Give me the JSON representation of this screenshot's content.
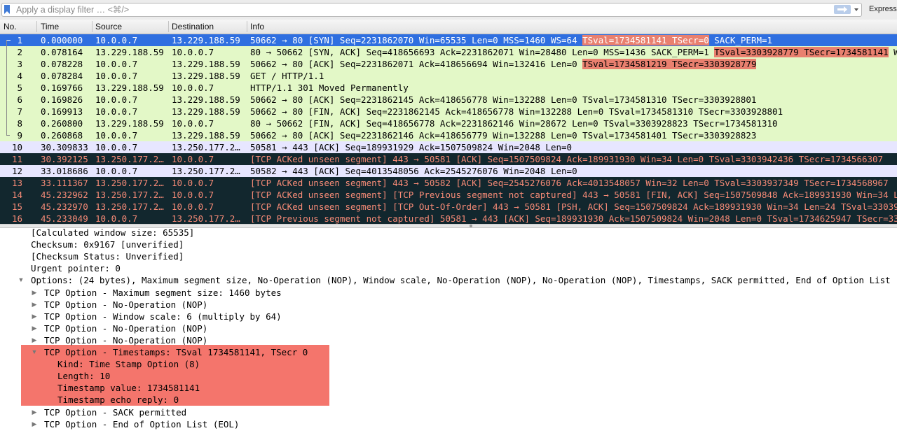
{
  "filter": {
    "placeholder": "Apply a display filter … <⌘/>",
    "expression_label": "Expressio"
  },
  "columns": {
    "no": "No.",
    "time": "Time",
    "source": "Source",
    "destination": "Destination",
    "info": "Info"
  },
  "packets": [
    {
      "no": "1",
      "time": "0.000000",
      "src": "10.0.0.7",
      "dst": "13.229.188.59",
      "info_a": "50662 → 80 [SYN] Seq=2231862070 Win=65535 Len=0 MSS=1460 WS=64 ",
      "info_hl": "TSval=1734581141 TSecr=0",
      "info_b": " SACK_PERM=1",
      "style": "selected"
    },
    {
      "no": "2",
      "time": "0.078164",
      "src": "13.229.188.59",
      "dst": "10.0.0.7",
      "info_a": "80 → 50662 [SYN, ACK] Seq=418656693 Ack=2231862071 Win=28480 Len=0 MSS=1436 SACK_PERM=1 ",
      "info_hl": "TSval=3303928779 TSecr=1734581141",
      "info_b": " WS",
      "style": "green"
    },
    {
      "no": "3",
      "time": "0.078228",
      "src": "10.0.0.7",
      "dst": "13.229.188.59",
      "info_a": "50662 → 80 [ACK] Seq=2231862071 Ack=418656694 Win=132416 Len=0 ",
      "info_hl": "TSval=1734581219 TSecr=3303928779 ",
      "info_b": "",
      "style": "green"
    },
    {
      "no": "4",
      "time": "0.078284",
      "src": "10.0.0.7",
      "dst": "13.229.188.59",
      "info_a": "GET / HTTP/1.1",
      "info_hl": "",
      "info_b": "",
      "style": "green"
    },
    {
      "no": "5",
      "time": "0.169766",
      "src": "13.229.188.59",
      "dst": "10.0.0.7",
      "info_a": "HTTP/1.1 301 Moved Permanently",
      "info_hl": "",
      "info_b": "",
      "style": "green"
    },
    {
      "no": "6",
      "time": "0.169826",
      "src": "10.0.0.7",
      "dst": "13.229.188.59",
      "info_a": "50662 → 80 [ACK] Seq=2231862145 Ack=418656778 Win=132288 Len=0 TSval=1734581310 TSecr=3303928801",
      "info_hl": "",
      "info_b": "",
      "style": "green"
    },
    {
      "no": "7",
      "time": "0.169913",
      "src": "10.0.0.7",
      "dst": "13.229.188.59",
      "info_a": "50662 → 80 [FIN, ACK] Seq=2231862145 Ack=418656778 Win=132288 Len=0 TSval=1734581310 TSecr=3303928801",
      "info_hl": "",
      "info_b": "",
      "style": "green"
    },
    {
      "no": "8",
      "time": "0.260800",
      "src": "13.229.188.59",
      "dst": "10.0.0.7",
      "info_a": "80 → 50662 [FIN, ACK] Seq=418656778 Ack=2231862146 Win=28672 Len=0 TSval=3303928823 TSecr=1734581310",
      "info_hl": "",
      "info_b": "",
      "style": "green"
    },
    {
      "no": "9",
      "time": "0.260868",
      "src": "10.0.0.7",
      "dst": "13.229.188.59",
      "info_a": "50662 → 80 [ACK] Seq=2231862146 Ack=418656779 Win=132288 Len=0 TSval=1734581401 TSecr=3303928823",
      "info_hl": "",
      "info_b": "",
      "style": "green"
    },
    {
      "no": "10",
      "time": "30.309833",
      "src": "10.0.0.7",
      "dst": "13.250.177.2…",
      "info_a": "50581 → 443 [ACK] Seq=189931929 Ack=1507509824 Win=2048 Len=0",
      "info_hl": "",
      "info_b": "",
      "style": "lav"
    },
    {
      "no": "11",
      "time": "30.392125",
      "src": "13.250.177.2…",
      "dst": "10.0.0.7",
      "info_a": "[TCP ACKed unseen segment] 443 → 50581 [ACK] Seq=1507509824 Ack=189931930 Win=34 Len=0 TSval=3303942436 TSecr=1734566307",
      "info_hl": "",
      "info_b": "",
      "style": "dark"
    },
    {
      "no": "12",
      "time": "33.018686",
      "src": "10.0.0.7",
      "dst": "13.250.177.2…",
      "info_a": "50582 → 443 [ACK] Seq=4013548056 Ack=2545276076 Win=2048 Len=0",
      "info_hl": "",
      "info_b": "",
      "style": "lav"
    },
    {
      "no": "13",
      "time": "33.111367",
      "src": "13.250.177.2…",
      "dst": "10.0.0.7",
      "info_a": "[TCP ACKed unseen segment] 443 → 50582 [ACK] Seq=2545276076 Ack=4013548057 Win=32 Len=0 TSval=3303937349 TSecr=1734568967",
      "info_hl": "",
      "info_b": "",
      "style": "dark"
    },
    {
      "no": "14",
      "time": "45.232962",
      "src": "13.250.177.2…",
      "dst": "10.0.0.7",
      "info_a": "[TCP ACKed unseen segment] [TCP Previous segment not captured] 443 → 50581 [FIN, ACK] Seq=1507509848 Ack=189931930 Win=34 Le",
      "info_hl": "",
      "info_b": "",
      "style": "dark"
    },
    {
      "no": "15",
      "time": "45.232970",
      "src": "13.250.177.2…",
      "dst": "10.0.0.7",
      "info_a": "[TCP ACKed unseen segment] [TCP Out-Of-Order] 443 → 50581 [PSH, ACK] Seq=1507509824 Ack=189931930 Win=34 Len=24 TSval=330394",
      "info_hl": "",
      "info_b": "",
      "style": "dark"
    },
    {
      "no": "16",
      "time": "45.233049",
      "src": "10.0.0.7",
      "dst": "13.250.177.2…",
      "info_a": "[TCP Previous segment not captured] 50581 → 443 [ACK] Seq=189931930 Ack=1507509824 Win=2048 Len=0 TSval=1734625947 TSecr=330",
      "info_hl": "",
      "info_b": "",
      "style": "dark"
    }
  ],
  "details": [
    {
      "text": "[Calculated window size: 65535]",
      "indent": 0,
      "toggle": "none"
    },
    {
      "text": "Checksum: 0x9167 [unverified]",
      "indent": 0,
      "toggle": "none"
    },
    {
      "text": "[Checksum Status: Unverified]",
      "indent": 0,
      "toggle": "none"
    },
    {
      "text": "Urgent pointer: 0",
      "indent": 0,
      "toggle": "none"
    },
    {
      "text": "Options: (24 bytes), Maximum segment size, No-Operation (NOP), Window scale, No-Operation (NOP), No-Operation (NOP), Timestamps, SACK permitted, End of Option List (E",
      "indent": 0,
      "toggle": "open"
    },
    {
      "text": "TCP Option - Maximum segment size: 1460 bytes",
      "indent": 1,
      "toggle": "closed"
    },
    {
      "text": "TCP Option - No-Operation (NOP)",
      "indent": 1,
      "toggle": "closed"
    },
    {
      "text": "TCP Option - Window scale: 6 (multiply by 64)",
      "indent": 1,
      "toggle": "closed"
    },
    {
      "text": "TCP Option - No-Operation (NOP)",
      "indent": 1,
      "toggle": "closed"
    },
    {
      "text": "TCP Option - No-Operation (NOP)",
      "indent": 1,
      "toggle": "closed"
    },
    {
      "text": "TCP Option - Timestamps: TSval 1734581141, TSecr 0",
      "indent": 1,
      "toggle": "open"
    },
    {
      "text": "Kind: Time Stamp Option (8)",
      "indent": 2,
      "toggle": "none"
    },
    {
      "text": "Length: 10",
      "indent": 2,
      "toggle": "none"
    },
    {
      "text": "Timestamp value: 1734581141",
      "indent": 2,
      "toggle": "none"
    },
    {
      "text": "Timestamp echo reply: 0",
      "indent": 2,
      "toggle": "none"
    },
    {
      "text": "TCP Option - SACK permitted",
      "indent": 1,
      "toggle": "closed"
    },
    {
      "text": "TCP Option - End of Option List (EOL)",
      "indent": 1,
      "toggle": "closed"
    }
  ],
  "colors": {
    "selected_bg": "#2f6fe0",
    "green_bg": "#e3f8c7",
    "lav_bg": "#e7e6ff",
    "dark_bg": "#12272e",
    "dark_fg": "#f78b77",
    "highlight": "#f4756c"
  }
}
